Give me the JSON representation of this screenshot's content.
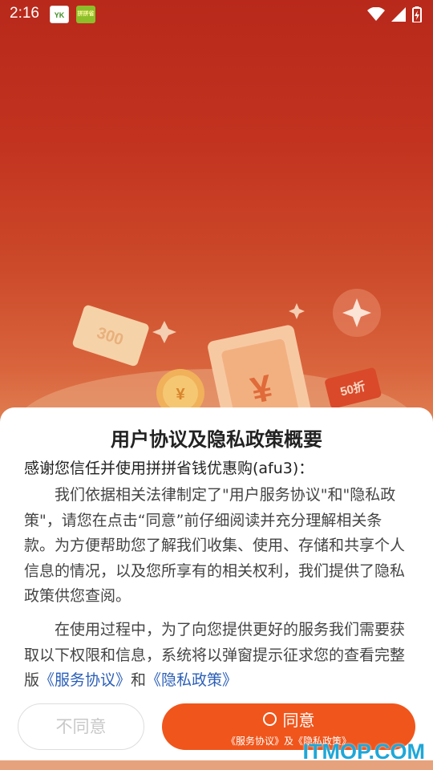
{
  "status_bar": {
    "time": "2:16",
    "app_icons": [
      "yk-app-icon",
      "green-app-icon"
    ],
    "app_icon_texts": [
      "YK",
      "拼拼省钱"
    ],
    "indicators": [
      "wifi-icon",
      "signal-icon",
      "battery-icon"
    ]
  },
  "illustration": {
    "coupon_left": "300",
    "coupon_right": "50折",
    "currency": "¥"
  },
  "dialog": {
    "title": "用户协议及隐私政策概要",
    "intro": "感谢您信任并使用拼拼省钱优惠购(afu3)：",
    "paragraph1": "我们依据相关法律制定了\"用户服务协议\"和\"隐私政策\"，请您在点击“同意”前仔细阅读并充分理解相关条款。为方便帮助您了解我们收集、使用、存储和共享个人信息的情况，以及您所享有的相关权利，我们提供了隐私政策供您查阅。",
    "paragraph2": "在使用过程中，为了向您提供更好的服务我们需要获取以下权限和信息，系统将以弹窗提示征求您的查看完整版",
    "link_service": "《服务协议》",
    "and_text": "和",
    "link_privacy": "《隐私政策》",
    "disagree_label": "不同意",
    "agree_label": "同意",
    "agree_sub": "《服务协议》及《隐私政策》"
  },
  "watermark": "ITMOP.COM",
  "colors": {
    "accent": "#f0551b",
    "link": "#2b5fb8",
    "background_top": "#b8291b",
    "watermark": "#1fa7d8"
  }
}
